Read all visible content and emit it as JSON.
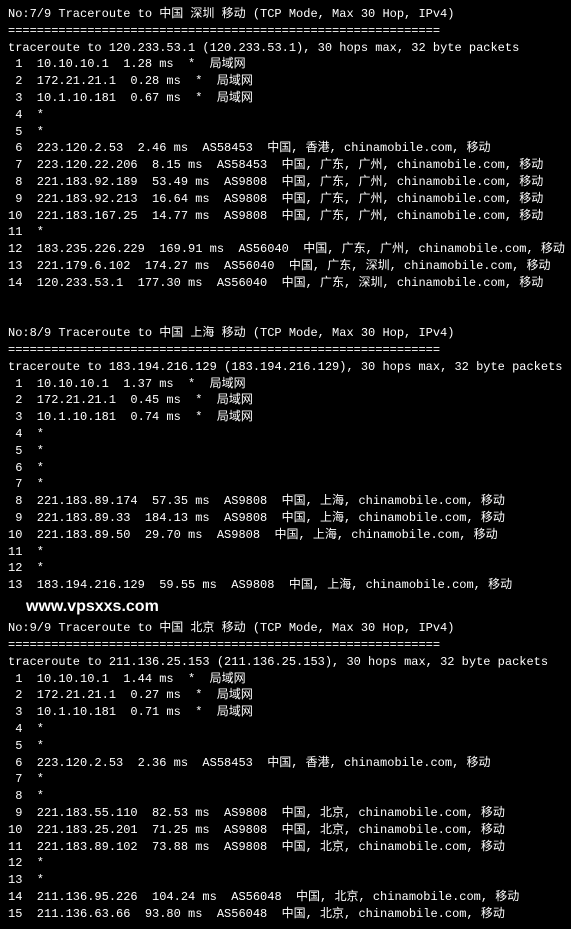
{
  "sections": [
    {
      "header": "No:7/9 Traceroute to 中国 深圳 移动 (TCP Mode, Max 30 Hop, IPv4)",
      "divider": "============================================================",
      "intro": "traceroute to 120.233.53.1 (120.233.53.1), 30 hops max, 32 byte packets",
      "hops": [
        " 1  10.10.10.1  1.28 ms  *  局域网",
        " 2  172.21.21.1  0.28 ms  *  局域网",
        " 3  10.1.10.181  0.67 ms  *  局域网",
        " 4  *",
        " 5  *",
        " 6  223.120.2.53  2.46 ms  AS58453  中国, 香港, chinamobile.com, 移动",
        " 7  223.120.22.206  8.15 ms  AS58453  中国, 广东, 广州, chinamobile.com, 移动",
        " 8  221.183.92.189  53.49 ms  AS9808  中国, 广东, 广州, chinamobile.com, 移动",
        " 9  221.183.92.213  16.64 ms  AS9808  中国, 广东, 广州, chinamobile.com, 移动",
        "10  221.183.167.25  14.77 ms  AS9808  中国, 广东, 广州, chinamobile.com, 移动",
        "11  *",
        "12  183.235.226.229  169.91 ms  AS56040  中国, 广东, 广州, chinamobile.com, 移动",
        "13  221.179.6.102  174.27 ms  AS56040  中国, 广东, 深圳, chinamobile.com, 移动",
        "14  120.233.53.1  177.30 ms  AS56040  中国, 广东, 深圳, chinamobile.com, 移动"
      ]
    },
    {
      "header": "No:8/9 Traceroute to 中国 上海 移动 (TCP Mode, Max 30 Hop, IPv4)",
      "divider": "============================================================",
      "intro": "traceroute to 183.194.216.129 (183.194.216.129), 30 hops max, 32 byte packets",
      "hops": [
        " 1  10.10.10.1  1.37 ms  *  局域网",
        " 2  172.21.21.1  0.45 ms  *  局域网",
        " 3  10.1.10.181  0.74 ms  *  局域网",
        " 4  *",
        " 5  *",
        " 6  *",
        " 7  *",
        " 8  221.183.89.174  57.35 ms  AS9808  中国, 上海, chinamobile.com, 移动",
        " 9  221.183.89.33  184.13 ms  AS9808  中国, 上海, chinamobile.com, 移动",
        "10  221.183.89.50  29.70 ms  AS9808  中国, 上海, chinamobile.com, 移动",
        "11  *",
        "12  *",
        "13  183.194.216.129  59.55 ms  AS9808  中国, 上海, chinamobile.com, 移动"
      ]
    },
    {
      "header": "No:9/9 Traceroute to 中国 北京 移动 (TCP Mode, Max 30 Hop, IPv4)",
      "divider": "============================================================",
      "intro": "traceroute to 211.136.25.153 (211.136.25.153), 30 hops max, 32 byte packets",
      "hops": [
        " 1  10.10.10.1  1.44 ms  *  局域网",
        " 2  172.21.21.1  0.27 ms  *  局域网",
        " 3  10.1.10.181  0.71 ms  *  局域网",
        " 4  *",
        " 5  *",
        " 6  223.120.2.53  2.36 ms  AS58453  中国, 香港, chinamobile.com, 移动",
        " 7  *",
        " 8  *",
        " 9  221.183.55.110  82.53 ms  AS9808  中国, 北京, chinamobile.com, 移动",
        "10  221.183.25.201  71.25 ms  AS9808  中国, 北京, chinamobile.com, 移动",
        "11  221.183.89.102  73.88 ms  AS9808  中国, 北京, chinamobile.com, 移动",
        "12  *",
        "13  *",
        "14  211.136.95.226  104.24 ms  AS56048  中国, 北京, chinamobile.com, 移动",
        "15  211.136.63.66  93.80 ms  AS56048  中国, 北京, chinamobile.com, 移动"
      ]
    }
  ],
  "watermark": "www.vpsxxs.com",
  "watermark_before_section": 2
}
